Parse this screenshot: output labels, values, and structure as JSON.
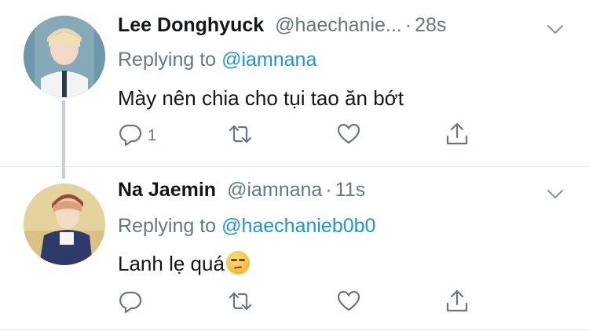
{
  "tweets": [
    {
      "display_name": "Lee Donghyuck",
      "handle": "@haechanie...",
      "separator": "·",
      "time": "28s",
      "replying_label": "Replying to",
      "replying_to": "@iamnana",
      "text": "Mày nên chia cho tụi tao ăn bớt",
      "emoji": "",
      "reply_count": "1",
      "icons": {
        "reply": "reply-icon",
        "retweet": "retweet-icon",
        "like": "heart-icon",
        "share": "share-icon",
        "menu": "chevron-down-icon"
      }
    },
    {
      "display_name": "Na Jaemin",
      "handle": "@iamnana",
      "separator": "·",
      "time": "11s",
      "replying_label": "Replying to",
      "replying_to": "@haechanieb0b0",
      "text": "Lanh lẹ quá",
      "emoji": "unamused-face-emoji",
      "reply_count": "",
      "icons": {
        "reply": "reply-icon",
        "retweet": "retweet-icon",
        "like": "heart-icon",
        "share": "share-icon",
        "menu": "chevron-down-icon"
      }
    }
  ],
  "colors": {
    "text_primary": "#14171a",
    "text_secondary": "#657786",
    "link_blue": "#1b95e0",
    "thread_line": "#c4cfd6",
    "divider": "#e1e8ed"
  }
}
